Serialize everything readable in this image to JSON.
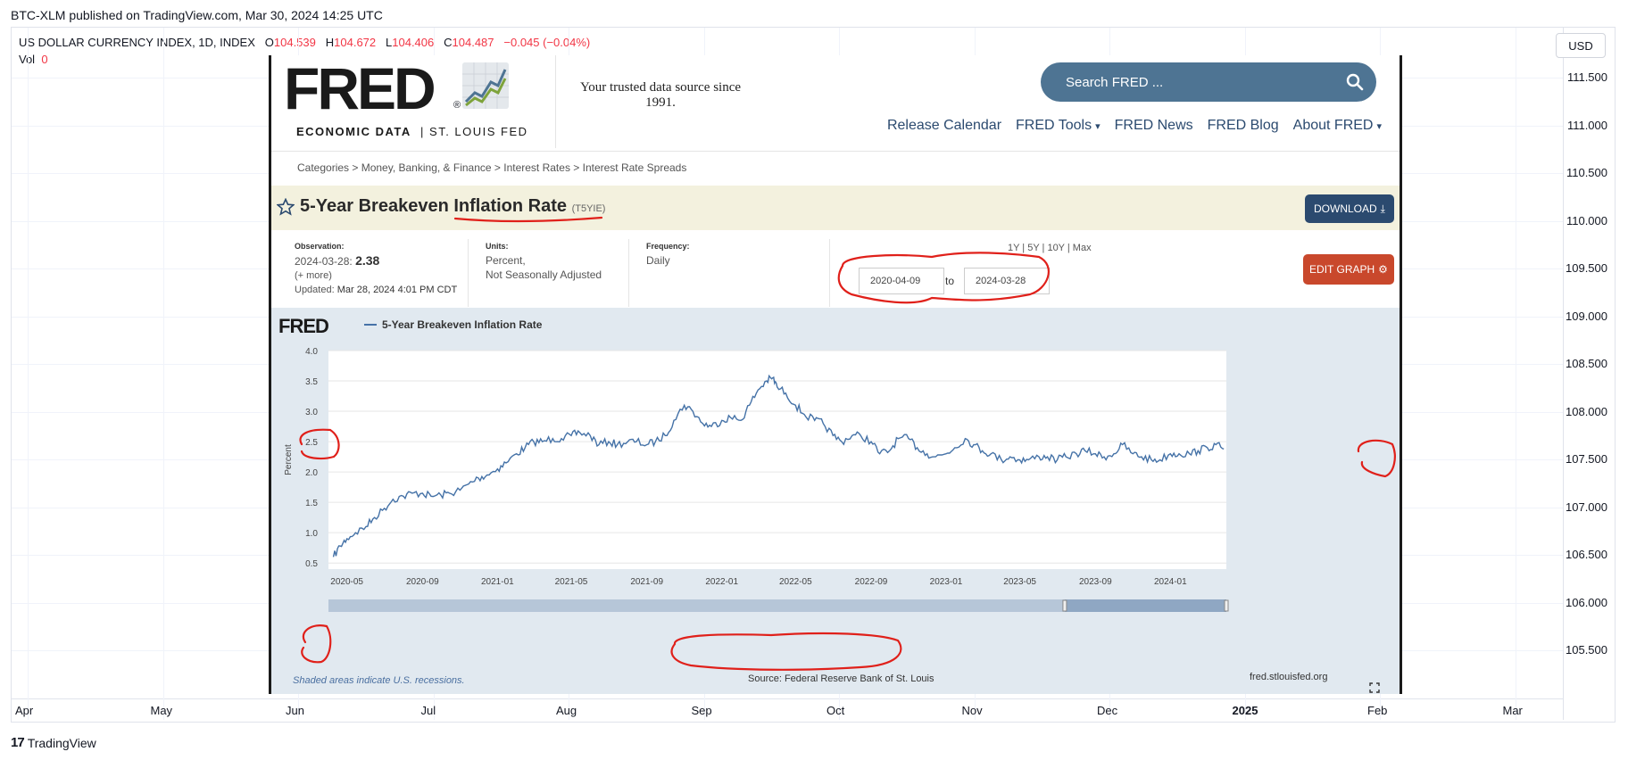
{
  "tradingview": {
    "published": "BTC-XLM published on TradingView.com, Mar 30, 2024 14:25 UTC",
    "symbol": "US DOLLAR CURRENCY INDEX, 1D, INDEX",
    "open_label": "O",
    "open": "104.539",
    "high_label": "H",
    "high": "104.672",
    "low_label": "L",
    "low": "104.406",
    "close_label": "C",
    "close": "104.487",
    "change": "−0.045 (−0.04%)",
    "vol_label": "Vol",
    "vol_value": "0",
    "currency": "USD",
    "price_axis": [
      "111.500",
      "111.000",
      "110.500",
      "110.000",
      "109.500",
      "109.000",
      "108.500",
      "108.000",
      "107.500",
      "107.000",
      "106.500",
      "106.000",
      "105.500"
    ],
    "time_axis": [
      "Apr",
      "May",
      "Jun",
      "Jul",
      "Aug",
      "Sep",
      "Oct",
      "Nov",
      "Dec",
      "2025",
      "Feb",
      "Mar"
    ],
    "logo_text": "TradingView",
    "colors": {
      "down": "#f23645",
      "text": "#131722"
    }
  },
  "fred": {
    "logo_word": "FRED",
    "logo_sub_bold": "ECONOMIC DATA",
    "logo_sub_rest": "|  ST. LOUIS FED",
    "tagline": "Your trusted data source since 1991.",
    "search_placeholder": "Search FRED ...",
    "nav": [
      "Release Calendar",
      "FRED Tools",
      "FRED News",
      "FRED Blog",
      "About FRED"
    ],
    "breadcrumb": "Categories > Money, Banking, & Finance > Interest Rates > Interest Rate Spreads",
    "title": "5-Year Breakeven Inflation Rate",
    "series_code": "(T5YIE)",
    "download_label": "DOWNLOAD",
    "observation_label": "Observation:",
    "observation_date": "2024-03-28:",
    "observation_value": "2.38",
    "more_link": "(+ more)",
    "updated_label": "Updated:",
    "updated_value": "Mar 28, 2024 4:01 PM CDT",
    "units_label": "Units:",
    "units_value_1": "Percent,",
    "units_value_2": "Not Seasonally Adjusted",
    "frequency_label": "Frequency:",
    "frequency_value": "Daily",
    "ranges": "1Y | 5Y | 10Y | Max",
    "date_from": "2020-04-09",
    "date_to_label": "to",
    "date_to": "2024-03-28",
    "edit_graph_label": "EDIT GRAPH",
    "chart_logo": "FRED",
    "footnote": "Shaded areas indicate U.S. recessions.",
    "source": "Source: Federal Reserve Bank of St. Louis",
    "site": "fred.stlouisfed.org",
    "colors": {
      "search": "#4e7493",
      "nav": "#2b4a6f",
      "download": "#2b4a6f",
      "edit": "#c9482c",
      "line": "#4572a7",
      "title_bar": "#f3f1de",
      "chart_bg": "#e1e9f0",
      "annotation": "#e0201a"
    }
  },
  "chart_data": {
    "type": "line",
    "title": "",
    "ylabel": "Percent",
    "ylim": [
      0.5,
      4.0
    ],
    "yticks": [
      "0.5",
      "1.0",
      "1.5",
      "2.0",
      "2.5",
      "3.0",
      "3.5",
      "4.0"
    ],
    "xticks": [
      "2020-05",
      "2020-09",
      "2021-01",
      "2021-05",
      "2021-09",
      "2022-01",
      "2022-05",
      "2022-09",
      "2023-01",
      "2023-05",
      "2023-09",
      "2024-01"
    ],
    "series": [
      {
        "name": "5-Year Breakeven Inflation Rate",
        "x": [
          "2020-04-09",
          "2020-04-20",
          "2020-05-01",
          "2020-05-15",
          "2020-06-01",
          "2020-06-15",
          "2020-07-01",
          "2020-07-15",
          "2020-08-01",
          "2020-08-15",
          "2020-09-01",
          "2020-09-15",
          "2020-10-01",
          "2020-10-15",
          "2020-11-01",
          "2020-11-15",
          "2020-12-01",
          "2020-12-15",
          "2021-01-01",
          "2021-01-15",
          "2021-02-01",
          "2021-02-15",
          "2021-03-01",
          "2021-03-15",
          "2021-04-01",
          "2021-04-15",
          "2021-05-01",
          "2021-05-15",
          "2021-06-01",
          "2021-06-15",
          "2021-07-01",
          "2021-07-15",
          "2021-08-01",
          "2021-08-15",
          "2021-09-01",
          "2021-09-15",
          "2021-10-01",
          "2021-10-15",
          "2021-11-01",
          "2021-11-15",
          "2021-12-01",
          "2021-12-15",
          "2022-01-01",
          "2022-01-15",
          "2022-02-01",
          "2022-02-15",
          "2022-03-01",
          "2022-03-15",
          "2022-03-25",
          "2022-04-01",
          "2022-04-15",
          "2022-05-01",
          "2022-05-15",
          "2022-06-01",
          "2022-06-15",
          "2022-07-01",
          "2022-07-15",
          "2022-08-01",
          "2022-08-15",
          "2022-09-01",
          "2022-09-15",
          "2022-10-01",
          "2022-10-15",
          "2022-11-01",
          "2022-11-15",
          "2022-12-01",
          "2022-12-15",
          "2023-01-01",
          "2023-01-15",
          "2023-02-01",
          "2023-02-15",
          "2023-03-01",
          "2023-03-15",
          "2023-04-01",
          "2023-04-15",
          "2023-05-01",
          "2023-05-15",
          "2023-06-01",
          "2023-06-15",
          "2023-07-01",
          "2023-07-15",
          "2023-08-01",
          "2023-08-15",
          "2023-09-01",
          "2023-09-15",
          "2023-10-01",
          "2023-10-15",
          "2023-11-01",
          "2023-11-15",
          "2023-12-01",
          "2023-12-15",
          "2024-01-01",
          "2024-01-15",
          "2024-02-01",
          "2024-02-15",
          "2024-03-01",
          "2024-03-15",
          "2024-03-28"
        ],
        "values": [
          0.6,
          0.78,
          0.9,
          1.0,
          1.1,
          1.25,
          1.4,
          1.55,
          1.6,
          1.65,
          1.65,
          1.6,
          1.62,
          1.65,
          1.7,
          1.8,
          1.9,
          1.95,
          2.05,
          2.15,
          2.3,
          2.4,
          2.5,
          2.5,
          2.55,
          2.55,
          2.6,
          2.65,
          2.6,
          2.45,
          2.5,
          2.45,
          2.5,
          2.5,
          2.45,
          2.5,
          2.6,
          2.85,
          3.1,
          3.0,
          2.8,
          2.75,
          2.85,
          2.9,
          2.85,
          3.1,
          3.35,
          3.5,
          3.55,
          3.4,
          3.3,
          3.1,
          2.95,
          2.85,
          2.8,
          2.6,
          2.5,
          2.6,
          2.6,
          2.5,
          2.3,
          2.35,
          2.55,
          2.55,
          2.4,
          2.3,
          2.25,
          2.3,
          2.4,
          2.55,
          2.45,
          2.35,
          2.3,
          2.2,
          2.25,
          2.2,
          2.2,
          2.25,
          2.25,
          2.2,
          2.25,
          2.3,
          2.35,
          2.3,
          2.25,
          2.3,
          2.45,
          2.3,
          2.25,
          2.2,
          2.2,
          2.3,
          2.3,
          2.3,
          2.35,
          2.4,
          2.45,
          2.38
        ]
      }
    ],
    "annotations": [
      "circle: y-axis 2.5",
      "circle: y-axis 0.5",
      "circle: latest value",
      "circle: date range",
      "underline: title",
      "circle: source"
    ]
  }
}
